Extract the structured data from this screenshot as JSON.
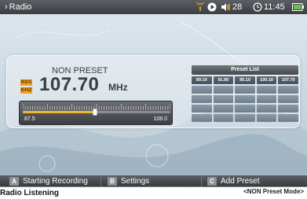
{
  "topbar": {
    "title": "Radio",
    "volume": "28",
    "time": "11:45",
    "icons": [
      "radio-signal-icon",
      "play-icon",
      "volume-icon",
      "clock-icon",
      "battery-icon"
    ]
  },
  "tuner": {
    "mode_label": "NON PRESET",
    "frequency": "107.70",
    "unit": "MHz",
    "badges": {
      "rds": "RDS",
      "khz": "KHZ"
    },
    "range_min": "87.5",
    "range_max": "108.0",
    "slider_fraction": 0.49
  },
  "preset_list": {
    "title": "Preset List",
    "presets": [
      "89.10",
      "91.90",
      "95.10",
      "100.10",
      "107.70"
    ],
    "empty_rows": 4,
    "columns": 5
  },
  "function_bar": {
    "a": {
      "key": "A",
      "label": "Starting Recording"
    },
    "b": {
      "key": "B",
      "label": "Settings"
    },
    "c": {
      "key": "C",
      "label": "Add Preset"
    }
  },
  "document": {
    "heading": "Radio Listening",
    "mode_caption": "<NON Preset Mode>"
  },
  "colors": {
    "accent": "#f2b92e",
    "bar": "#3a3d41",
    "background": "#cfdbe4"
  }
}
